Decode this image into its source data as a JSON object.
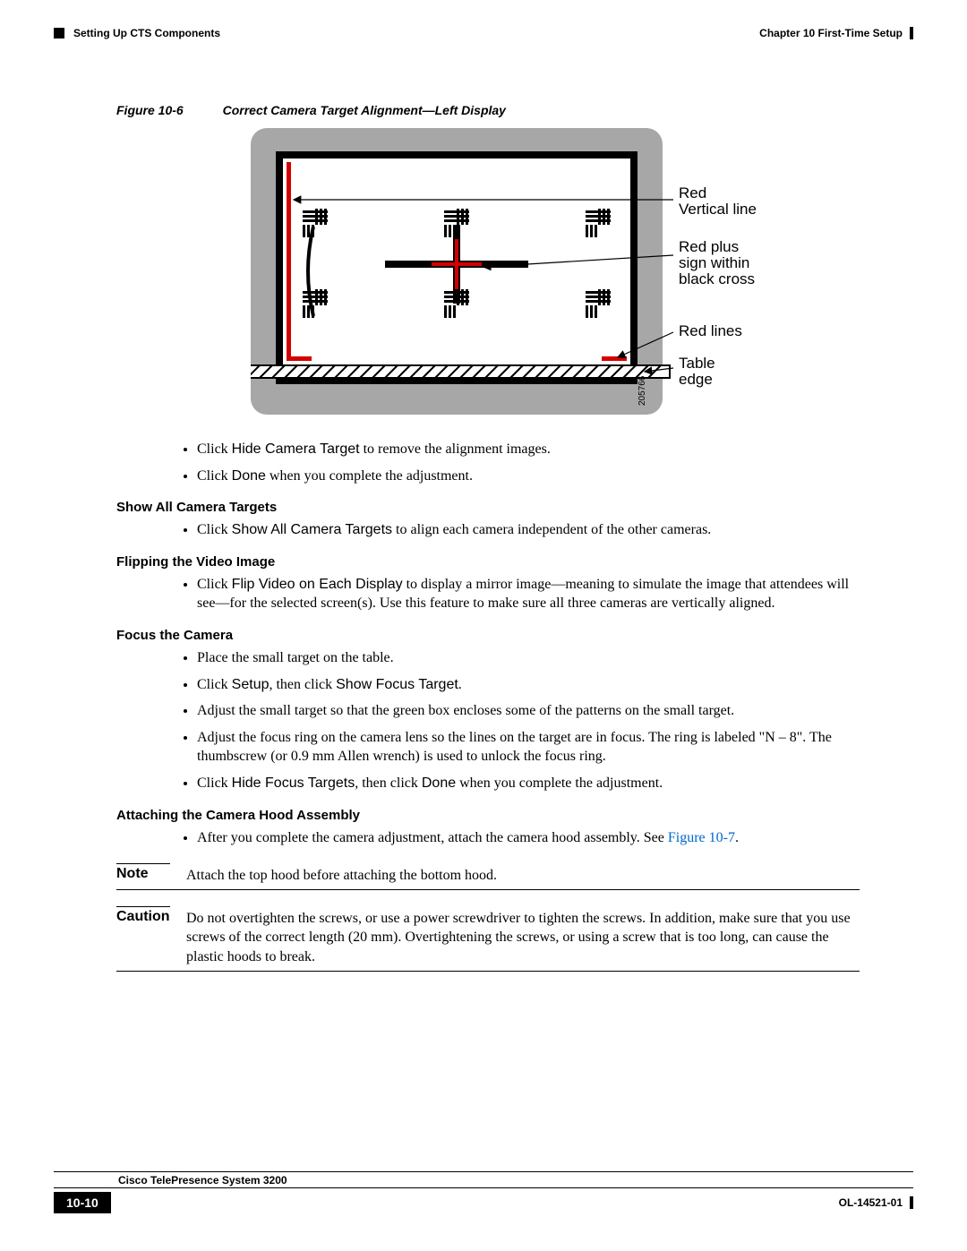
{
  "header": {
    "chapter": "Chapter 10    First-Time Setup",
    "section": "Setting Up CTS Components"
  },
  "figure": {
    "number": "Figure 10-6",
    "title": "Correct Camera Target Alignment—Left Display",
    "callouts": {
      "redVertical": "Red Vertical line",
      "redPlus": "Red plus sign within black cross",
      "redLines": "Red lines",
      "tableEdge": "Table edge"
    },
    "imageId": "205766"
  },
  "afterFigureBullets": [
    {
      "pre": "Click ",
      "sans": "Hide Camera Target",
      "post": " to remove the alignment images."
    },
    {
      "pre": "Click ",
      "sans": "Done",
      "post": " when you complete the adjustment."
    }
  ],
  "sections": [
    {
      "heading": "Show All Camera Targets",
      "bullets": [
        {
          "pre": "Click ",
          "sans": "Show All Camera Targets",
          "post": " to align each camera independent of the other cameras."
        }
      ]
    },
    {
      "heading": "Flipping the Video Image",
      "bullets": [
        {
          "pre": "Click ",
          "sans": "Flip Video on Each Display",
          "post": " to display a mirror image—meaning to simulate the image that attendees will see—for the selected screen(s). Use this feature to make sure all three cameras are vertically aligned."
        }
      ]
    },
    {
      "heading": "Focus the Camera",
      "bullets": [
        {
          "pre": "",
          "sans": "",
          "post": "Place the small target on the table."
        },
        {
          "pre": "Click ",
          "sans": "Setup",
          "post": ", then click ",
          "sans2": "Show Focus Target",
          "post2": "."
        },
        {
          "pre": "",
          "sans": "",
          "post": "Adjust the small target so that the green box encloses some of the patterns on the small target."
        },
        {
          "pre": "",
          "sans": "",
          "post": "Adjust the focus ring on the camera lens so the lines on the target are in focus. The ring is labeled \"N – 8\". The thumbscrew (or 0.9 mm Allen wrench) is used to unlock the focus ring."
        },
        {
          "pre": "Click ",
          "sans": "Hide Focus Targets",
          "post": ", then click ",
          "sans2": "Done",
          "post2": " when you complete the adjustment."
        }
      ]
    },
    {
      "heading": "Attaching the Camera Hood Assembly",
      "bullets": [
        {
          "pre": "",
          "sans": "",
          "post": "After you complete the camera adjustment, attach the camera hood assembly. See ",
          "linkText": "Figure 10-7",
          "post2": "."
        }
      ]
    }
  ],
  "note": {
    "label": "Note",
    "text": "Attach the top hood before attaching the bottom hood."
  },
  "caution": {
    "label": "Caution",
    "text": "Do not overtighten the screws, or use a power screwdriver to tighten the screws. In addition, make sure that you use screws of the correct length (20 mm). Overtightening the screws, or using a screw that is too long, can cause the plastic hoods to break."
  },
  "footer": {
    "product": "Cisco TelePresence System 3200",
    "pageNum": "10-10",
    "docId": "OL-14521-01"
  }
}
